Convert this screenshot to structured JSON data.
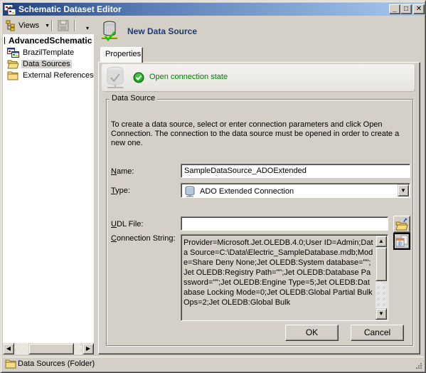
{
  "window": {
    "title": "Schematic Dataset Editor",
    "icons": {
      "app": "schematic-dataset-icon",
      "minimize": "minimize-icon",
      "maximize": "maximize-icon",
      "close": "close-icon"
    },
    "controls": {
      "minimize": "_",
      "maximize": "□",
      "close": "✕"
    }
  },
  "left_pane": {
    "toolbar": {
      "views_label": "Views",
      "views_icon": "views-icon",
      "save_icon": "save-icon"
    },
    "tree": {
      "root": "AdvancedSchematic",
      "items": [
        {
          "label": "BrazilTemplate",
          "icon": "template-icon",
          "selected": false
        },
        {
          "label": "Data Sources",
          "icon": "folder-open-icon",
          "selected": true
        },
        {
          "label": "External References",
          "icon": "folder-icon",
          "selected": false
        }
      ]
    }
  },
  "right_pane": {
    "header_title": "New Data Source",
    "tabs": [
      {
        "label": "Properties",
        "active": true
      }
    ],
    "status": {
      "text": "Open connection state",
      "color": "#008000"
    },
    "group_title": "Data Source",
    "description": "To create a data source, select or enter connection parameters and click Open Connection.  The connection to the data source must be opened in order to create a new one.",
    "fields": {
      "name": {
        "label_accel": "N",
        "label_rest": "ame:",
        "value": "SampleDataSource_ADOExtended"
      },
      "type": {
        "label_accel": "T",
        "label_rest": "ype:",
        "value": "ADO Extended Connection",
        "icon": "database-icon"
      },
      "udl_file": {
        "label_accel": "U",
        "label_rest": "DL File:",
        "value": ""
      },
      "connection_string": {
        "label_accel": "C",
        "label_rest": "onnection String:",
        "value": "Provider=Microsoft.Jet.OLEDB.4.0;User ID=Admin;Data Source=C:\\Data\\Electric_SampleDatabase.mdb;Mode=Share Deny None;Jet OLEDB:System database=\"\";Jet OLEDB:Registry Path=\"\";Jet OLEDB:Database Password=\"\";Jet OLEDB:Engine Type=5;Jet OLEDB:Database Locking Mode=0;Jet OLEDB:Global Partial Bulk Ops=2;Jet OLEDB:Global Bulk"
      }
    },
    "buttons": {
      "ok": "OK",
      "cancel": "Cancel"
    }
  },
  "statusbar": {
    "text": "Data Sources (Folder)",
    "icon": "folder-icon"
  },
  "colors": {
    "title_gradient_start": "#1f4280",
    "title_gradient_end": "#a5c9ef",
    "header_title": "#1f3a6e",
    "status_ok": "#008000"
  }
}
